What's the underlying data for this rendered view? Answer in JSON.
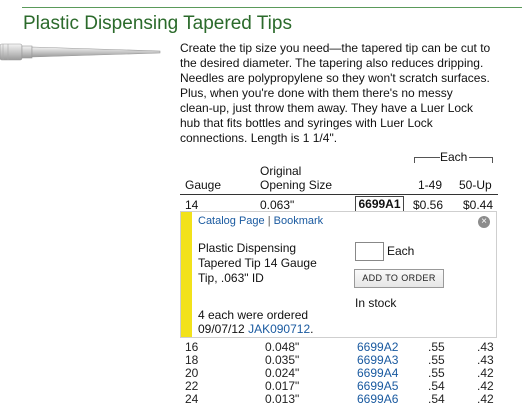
{
  "page": {
    "title": "Plastic Dispensing Tapered Tips",
    "description_lines": [
      "Create the tip size you need—the tapered tip can be cut to",
      "the desired diameter. The tapering also reduces dripping.",
      "Needles are polypropylene so they won't scratch surfaces.",
      "Plus, when you're done with them there's no messy",
      "clean-up, just throw them away. They have a Luer Lock",
      "hub that fits bottles and syringes with Luer Lock",
      "connections. Length is 1 1/4\"."
    ]
  },
  "table": {
    "each_header": "Each",
    "col_gauge": "Gauge",
    "col_opening_line1": "Original",
    "col_opening_line2": "Opening Size",
    "col_qty1": "1-49",
    "col_qty2": "50-Up",
    "first_row": {
      "gauge": "14",
      "opening": "0.063\"",
      "part": "6699A1",
      "price1": "$0.56",
      "price2": "$0.44"
    },
    "rows": [
      {
        "gauge": "16",
        "opening": "0.048\"",
        "part": "6699A2",
        "price1": ".55",
        "price2": ".43"
      },
      {
        "gauge": "18",
        "opening": "0.035\"",
        "part": "6699A3",
        "price1": ".55",
        "price2": ".43"
      },
      {
        "gauge": "20",
        "opening": "0.024\"",
        "part": "6699A4",
        "price1": ".55",
        "price2": ".42"
      },
      {
        "gauge": "22",
        "opening": "0.017\"",
        "part": "6699A5",
        "price1": ".54",
        "price2": ".42"
      },
      {
        "gauge": "24",
        "opening": "0.013\"",
        "part": "6699A6",
        "price1": ".54",
        "price2": ".42"
      }
    ]
  },
  "panel": {
    "catalog_link": "Catalog Page",
    "separator": "|",
    "bookmark_link": "Bookmark",
    "close_icon": "×",
    "product_desc": "Plastic Dispensing Tapered Tip 14 Gauge Tip, .063\" ID",
    "qty_value": "",
    "qty_unit": "Each",
    "add_button": "ADD TO ORDER",
    "stock_status": "In stock",
    "ordered_line1": "4 each were ordered",
    "ordered_date": "09/07/12",
    "ordered_ref": "JAK090712",
    "ordered_end": ".",
    "accent_color": "#f2e21a"
  },
  "colors": {
    "title": "#2b6a2b",
    "link": "#1a5aa0"
  }
}
